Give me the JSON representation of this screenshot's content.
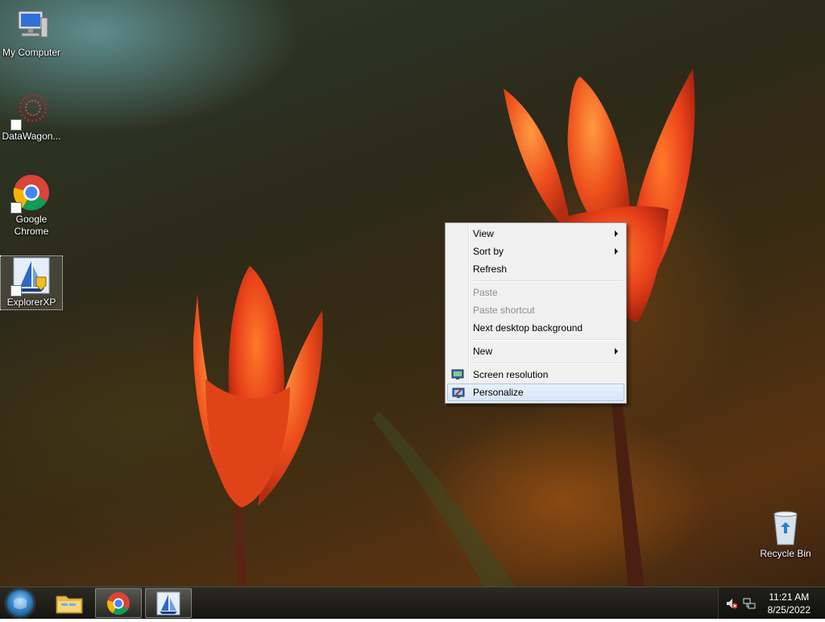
{
  "desktop": {
    "icons": [
      {
        "label": "My Computer",
        "icon": "my-computer-icon"
      },
      {
        "label": "DataWagon...",
        "icon": "datawagon-icon"
      },
      {
        "label": "Google Chrome",
        "icon": "chrome-icon"
      },
      {
        "label": "ExplorerXP",
        "icon": "explorerxp-icon"
      },
      {
        "label": "Recycle Bin",
        "icon": "recycle-bin-icon"
      }
    ],
    "selected_icon": "ExplorerXP"
  },
  "context_menu": {
    "items": [
      {
        "label": "View",
        "submenu": true
      },
      {
        "label": "Sort by",
        "submenu": true
      },
      {
        "label": "Refresh"
      },
      {
        "label": "Paste",
        "disabled": true
      },
      {
        "label": "Paste shortcut",
        "disabled": true
      },
      {
        "label": "Next desktop background"
      },
      {
        "label": "New",
        "submenu": true
      },
      {
        "label": "Screen resolution",
        "icon": "screen-resolution-icon"
      },
      {
        "label": "Personalize",
        "icon": "personalize-icon",
        "highlighted": true
      }
    ]
  },
  "taskbar": {
    "pinned": [
      "start-orb-icon",
      "file-explorer-icon",
      "chrome-icon",
      "explorerxp-icon"
    ],
    "clock": {
      "time": "11:21 AM",
      "date": "8/25/2022"
    },
    "tray_icons": [
      "volume-muted-icon",
      "network-icon"
    ]
  },
  "colors": {
    "menu_bg": "#f0f0f0",
    "menu_highlight": "#d6e6f8",
    "taskbar_bg": "#1e1e18",
    "tulip_red": "#e8401a"
  }
}
